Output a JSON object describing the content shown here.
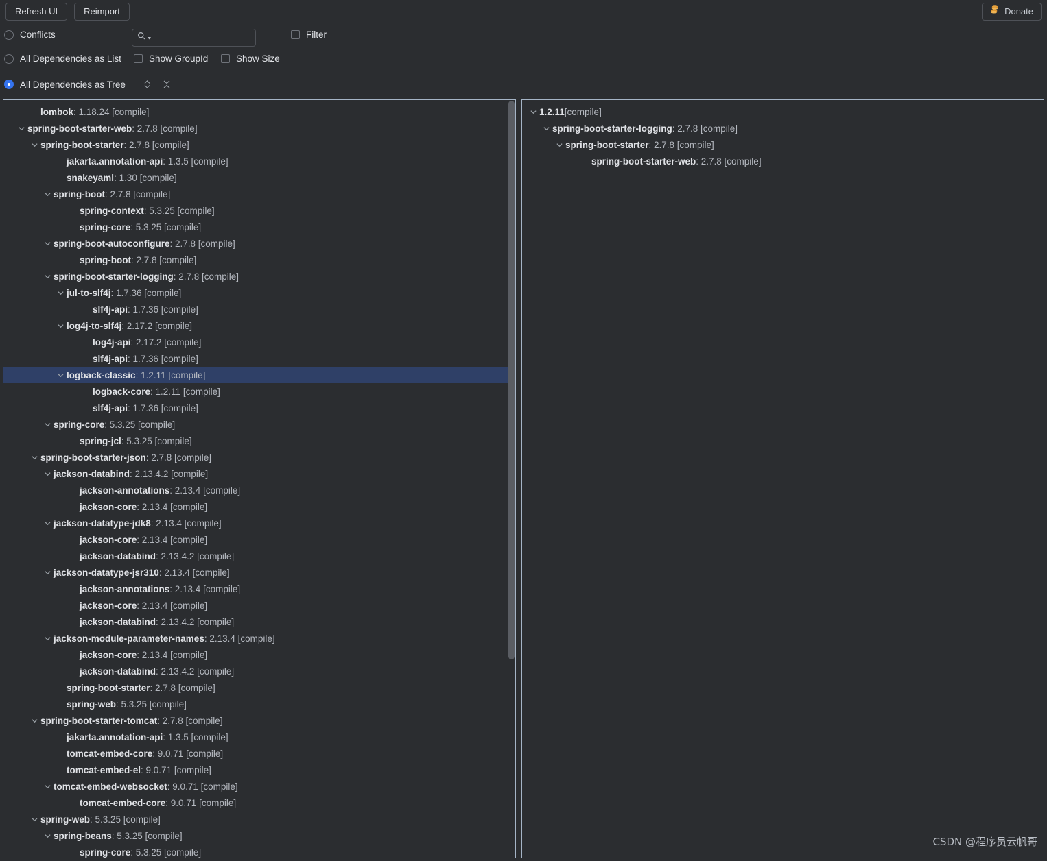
{
  "toolbar": {
    "refresh_label": "Refresh UI",
    "reimport_label": "Reimport",
    "donate_label": "Donate",
    "donate_icon": "coins-icon",
    "conflicts_label": "Conflicts",
    "list_label": "All Dependencies as List",
    "tree_label": "All Dependencies as Tree",
    "show_groupid_label": "Show GroupId",
    "show_size_label": "Show Size",
    "filter_label": "Filter",
    "search_value": "",
    "search_placeholder": "",
    "search_icon": "search-icon",
    "expand_icon": "expand-all-icon",
    "collapse_icon": "collapse-all-icon",
    "selected_mode": "tree",
    "conflicts_checked": false,
    "list_checked": false,
    "tree_checked": true,
    "show_groupid_checked": false,
    "show_size_checked": false,
    "filter_checked": false,
    "accent_color": "#3574f0",
    "selection_color": "#2f4067"
  },
  "left_tree": {
    "scroll_thumb_top": 0,
    "scroll_thumb_height": 815,
    "nodes": [
      {
        "depth": 1,
        "twisty": "none",
        "name": "lombok",
        "meta": " : 1.18.24 [compile]",
        "selected": false
      },
      {
        "depth": 0,
        "twisty": "open",
        "name": "spring-boot-starter-web",
        "meta": " : 2.7.8 [compile]",
        "selected": false
      },
      {
        "depth": 1,
        "twisty": "open",
        "name": "spring-boot-starter",
        "meta": " : 2.7.8 [compile]",
        "selected": false
      },
      {
        "depth": 3,
        "twisty": "none",
        "name": "jakarta.annotation-api",
        "meta": " : 1.3.5 [compile]",
        "selected": false
      },
      {
        "depth": 3,
        "twisty": "none",
        "name": "snakeyaml",
        "meta": " : 1.30 [compile]",
        "selected": false
      },
      {
        "depth": 2,
        "twisty": "open",
        "name": "spring-boot",
        "meta": " : 2.7.8 [compile]",
        "selected": false
      },
      {
        "depth": 4,
        "twisty": "none",
        "name": "spring-context",
        "meta": " : 5.3.25 [compile]",
        "selected": false
      },
      {
        "depth": 4,
        "twisty": "none",
        "name": "spring-core",
        "meta": " : 5.3.25 [compile]",
        "selected": false
      },
      {
        "depth": 2,
        "twisty": "open",
        "name": "spring-boot-autoconfigure",
        "meta": " : 2.7.8 [compile]",
        "selected": false
      },
      {
        "depth": 4,
        "twisty": "none",
        "name": "spring-boot",
        "meta": " : 2.7.8 [compile]",
        "selected": false
      },
      {
        "depth": 2,
        "twisty": "open",
        "name": "spring-boot-starter-logging",
        "meta": " : 2.7.8 [compile]",
        "selected": false
      },
      {
        "depth": 3,
        "twisty": "open",
        "name": "jul-to-slf4j",
        "meta": " : 1.7.36 [compile]",
        "selected": false
      },
      {
        "depth": 5,
        "twisty": "none",
        "name": "slf4j-api",
        "meta": " : 1.7.36 [compile]",
        "selected": false
      },
      {
        "depth": 3,
        "twisty": "open",
        "name": "log4j-to-slf4j",
        "meta": " : 2.17.2 [compile]",
        "selected": false
      },
      {
        "depth": 5,
        "twisty": "none",
        "name": "log4j-api",
        "meta": " : 2.17.2 [compile]",
        "selected": false
      },
      {
        "depth": 5,
        "twisty": "none",
        "name": "slf4j-api",
        "meta": " : 1.7.36 [compile]",
        "selected": false
      },
      {
        "depth": 3,
        "twisty": "open",
        "name": "logback-classic",
        "meta": " : 1.2.11 [compile]",
        "selected": true
      },
      {
        "depth": 5,
        "twisty": "none",
        "name": "logback-core",
        "meta": " : 1.2.11 [compile]",
        "selected": false
      },
      {
        "depth": 5,
        "twisty": "none",
        "name": "slf4j-api",
        "meta": " : 1.7.36 [compile]",
        "selected": false
      },
      {
        "depth": 2,
        "twisty": "open",
        "name": "spring-core",
        "meta": " : 5.3.25 [compile]",
        "selected": false
      },
      {
        "depth": 4,
        "twisty": "none",
        "name": "spring-jcl",
        "meta": " : 5.3.25 [compile]",
        "selected": false
      },
      {
        "depth": 1,
        "twisty": "open",
        "name": "spring-boot-starter-json",
        "meta": " : 2.7.8 [compile]",
        "selected": false
      },
      {
        "depth": 2,
        "twisty": "open",
        "name": "jackson-databind",
        "meta": " : 2.13.4.2 [compile]",
        "selected": false
      },
      {
        "depth": 4,
        "twisty": "none",
        "name": "jackson-annotations",
        "meta": " : 2.13.4 [compile]",
        "selected": false
      },
      {
        "depth": 4,
        "twisty": "none",
        "name": "jackson-core",
        "meta": " : 2.13.4 [compile]",
        "selected": false
      },
      {
        "depth": 2,
        "twisty": "open",
        "name": "jackson-datatype-jdk8",
        "meta": " : 2.13.4 [compile]",
        "selected": false
      },
      {
        "depth": 4,
        "twisty": "none",
        "name": "jackson-core",
        "meta": " : 2.13.4 [compile]",
        "selected": false
      },
      {
        "depth": 4,
        "twisty": "none",
        "name": "jackson-databind",
        "meta": " : 2.13.4.2 [compile]",
        "selected": false
      },
      {
        "depth": 2,
        "twisty": "open",
        "name": "jackson-datatype-jsr310",
        "meta": " : 2.13.4 [compile]",
        "selected": false
      },
      {
        "depth": 4,
        "twisty": "none",
        "name": "jackson-annotations",
        "meta": " : 2.13.4 [compile]",
        "selected": false
      },
      {
        "depth": 4,
        "twisty": "none",
        "name": "jackson-core",
        "meta": " : 2.13.4 [compile]",
        "selected": false
      },
      {
        "depth": 4,
        "twisty": "none",
        "name": "jackson-databind",
        "meta": " : 2.13.4.2 [compile]",
        "selected": false
      },
      {
        "depth": 2,
        "twisty": "open",
        "name": "jackson-module-parameter-names",
        "meta": " : 2.13.4 [compile]",
        "selected": false
      },
      {
        "depth": 4,
        "twisty": "none",
        "name": "jackson-core",
        "meta": " : 2.13.4 [compile]",
        "selected": false
      },
      {
        "depth": 4,
        "twisty": "none",
        "name": "jackson-databind",
        "meta": " : 2.13.4.2 [compile]",
        "selected": false
      },
      {
        "depth": 3,
        "twisty": "none",
        "name": "spring-boot-starter",
        "meta": " : 2.7.8 [compile]",
        "selected": false
      },
      {
        "depth": 3,
        "twisty": "none",
        "name": "spring-web",
        "meta": " : 5.3.25 [compile]",
        "selected": false
      },
      {
        "depth": 1,
        "twisty": "open",
        "name": "spring-boot-starter-tomcat",
        "meta": " : 2.7.8 [compile]",
        "selected": false
      },
      {
        "depth": 3,
        "twisty": "none",
        "name": "jakarta.annotation-api",
        "meta": " : 1.3.5 [compile]",
        "selected": false
      },
      {
        "depth": 3,
        "twisty": "none",
        "name": "tomcat-embed-core",
        "meta": " : 9.0.71 [compile]",
        "selected": false
      },
      {
        "depth": 3,
        "twisty": "none",
        "name": "tomcat-embed-el",
        "meta": " : 9.0.71 [compile]",
        "selected": false
      },
      {
        "depth": 2,
        "twisty": "open",
        "name": "tomcat-embed-websocket",
        "meta": " : 9.0.71 [compile]",
        "selected": false
      },
      {
        "depth": 4,
        "twisty": "none",
        "name": "tomcat-embed-core",
        "meta": " : 9.0.71 [compile]",
        "selected": false
      },
      {
        "depth": 1,
        "twisty": "open",
        "name": "spring-web",
        "meta": " : 5.3.25 [compile]",
        "selected": false
      },
      {
        "depth": 2,
        "twisty": "open",
        "name": "spring-beans",
        "meta": " : 5.3.25 [compile]",
        "selected": false
      },
      {
        "depth": 4,
        "twisty": "none",
        "name": "spring-core",
        "meta": " : 5.3.25 [compile]",
        "selected": false
      }
    ]
  },
  "right_tree": {
    "nodes": [
      {
        "depth": 0,
        "twisty": "open",
        "name": "1.2.11",
        "meta": " [compile]",
        "selected": false
      },
      {
        "depth": 1,
        "twisty": "open",
        "name": "spring-boot-starter-logging",
        "meta": " : 2.7.8 [compile]",
        "selected": false
      },
      {
        "depth": 2,
        "twisty": "open",
        "name": "spring-boot-starter",
        "meta": " : 2.7.8 [compile]",
        "selected": false
      },
      {
        "depth": 4,
        "twisty": "none",
        "name": "spring-boot-starter-web",
        "meta": " : 2.7.8 [compile]",
        "selected": false
      }
    ]
  },
  "watermark": {
    "text": "CSDN @程序员云帆哥"
  }
}
